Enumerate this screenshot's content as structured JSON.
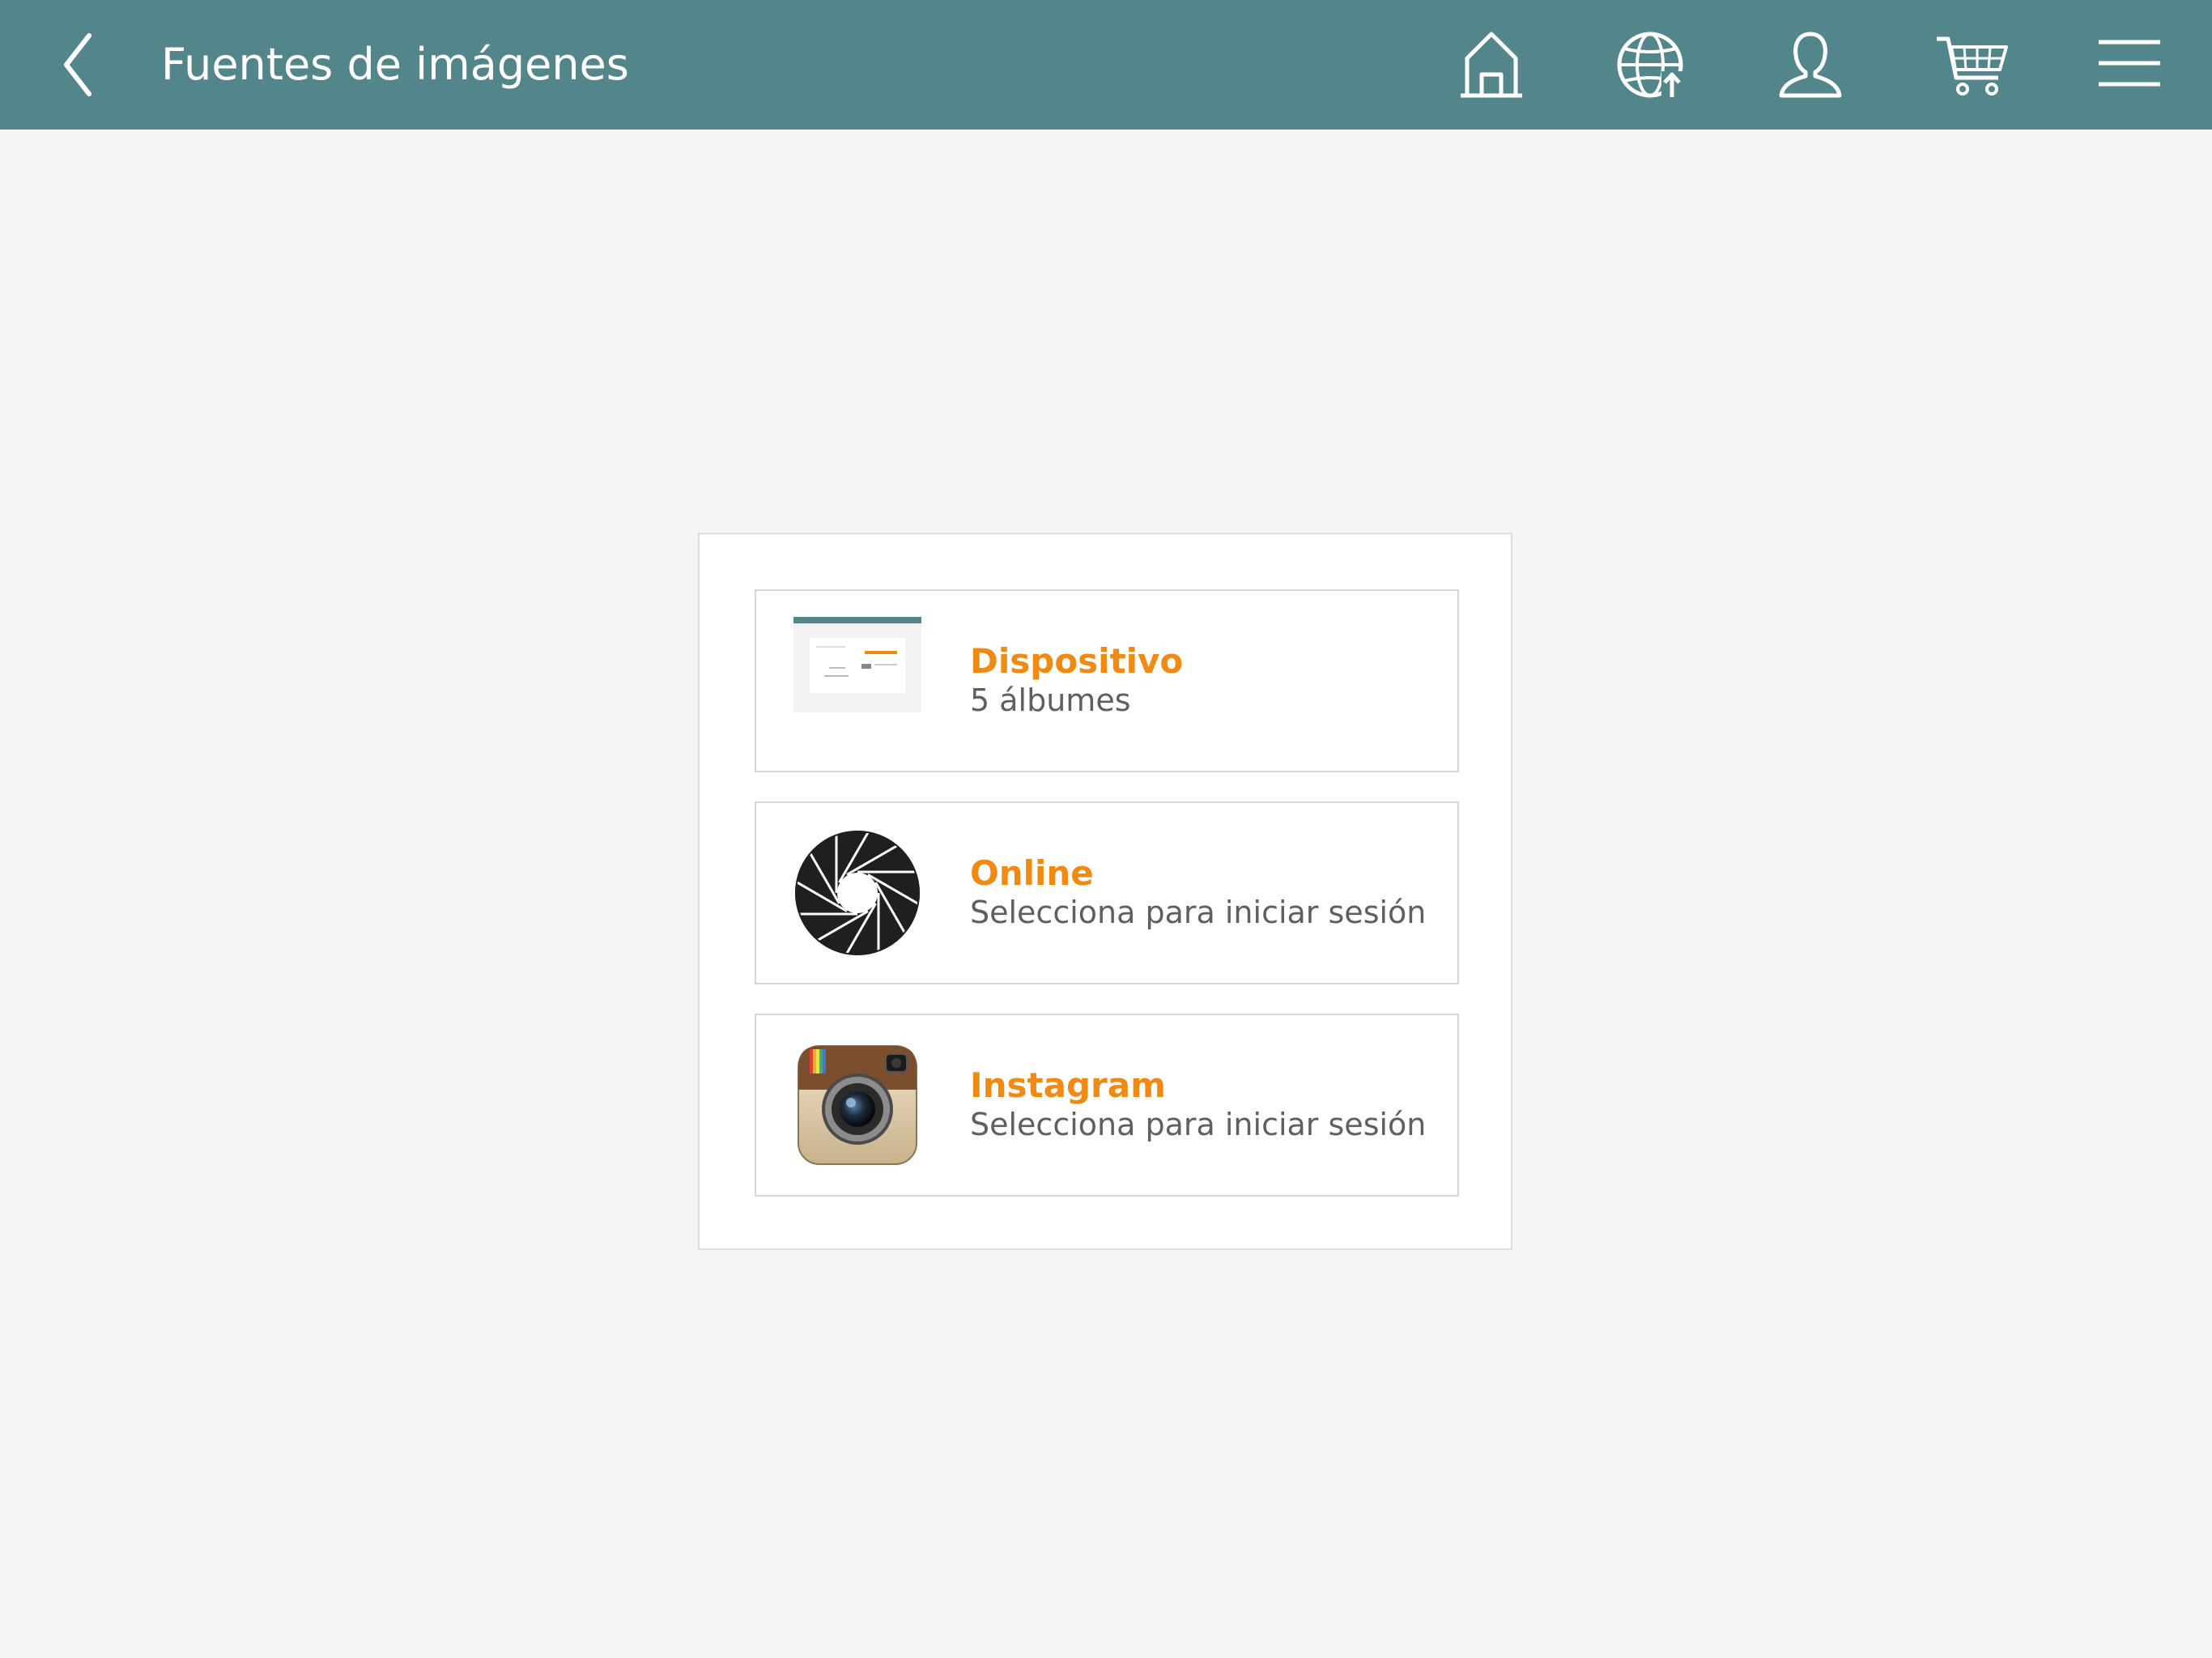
{
  "header": {
    "title": "Fuentes de imágenes",
    "background": "#52868b",
    "icons": [
      "chevron-left-icon",
      "home-icon",
      "globe-icon",
      "user-icon",
      "cart-icon",
      "menu-icon"
    ]
  },
  "sources": [
    {
      "name": "Dispositivo",
      "subtitle": "5 álbumes",
      "icon": "device-thumbnail"
    },
    {
      "name": "Online",
      "subtitle": "Selecciona para iniciar sesión",
      "icon": "aperture-icon"
    },
    {
      "name": "Instagram",
      "subtitle": "Selecciona para iniciar sesión",
      "icon": "instagram-icon"
    }
  ],
  "colors": {
    "accent": "#f08a12",
    "subtitle": "#5f5f5f",
    "background": "#f5f5f5",
    "header": "#52868b"
  }
}
